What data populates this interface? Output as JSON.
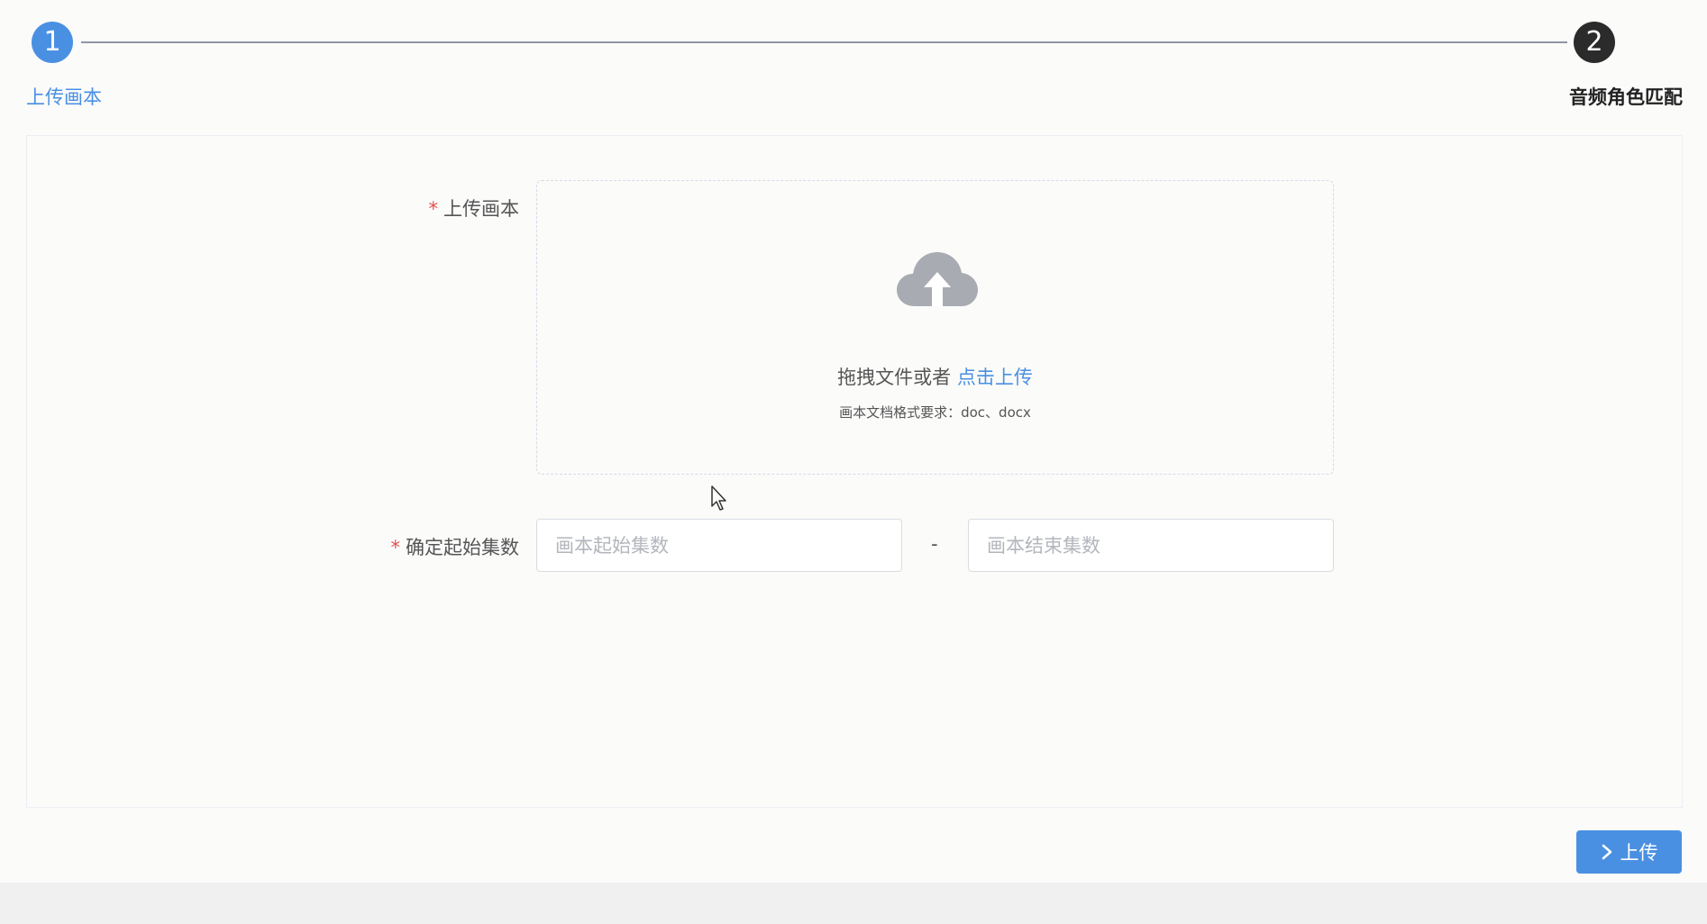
{
  "steps": [
    {
      "number": "1",
      "label": "上传画本",
      "state": "active",
      "color": "#4a90e2"
    },
    {
      "number": "2",
      "label": "音频角色匹配",
      "state": "pending",
      "color": "#2b2b2b"
    }
  ],
  "form": {
    "upload": {
      "label": "上传画本",
      "required_mark": "*",
      "drop_text": "拖拽文件或者",
      "drop_link": "点击上传",
      "hint": "画本文档格式要求：doc、docx",
      "icon": "cloud-upload-icon"
    },
    "range": {
      "label": "确定起始集数",
      "required_mark": "*",
      "start_placeholder": "画本起始集数",
      "end_placeholder": "画本结束集数",
      "separator": "-"
    }
  },
  "actions": {
    "upload_button": "上传",
    "upload_icon": "chevron-right-icon"
  },
  "colors": {
    "accent": "#4a90e2",
    "required": "#e05050"
  }
}
